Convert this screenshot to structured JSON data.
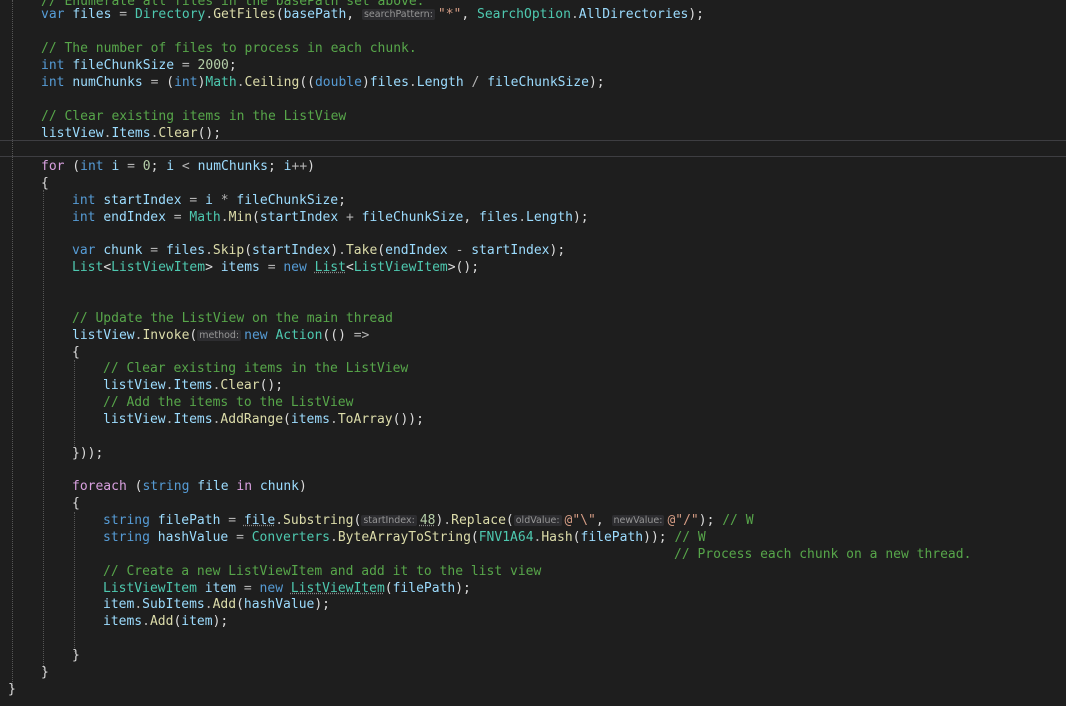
{
  "editor": {
    "language": "C#",
    "theme": {
      "background": "#1e1e1e",
      "keyword": "#569cd6",
      "control_keyword": "#d8a0df",
      "type": "#4ec9b0",
      "identifier": "#9cdcfe",
      "method": "#dcdcaa",
      "number": "#b5cea8",
      "string": "#d69d85",
      "comment": "#57a64a",
      "default": "#dcdcdc",
      "inlay_hint_background": "#2d2d30"
    },
    "lines": [
      [
        [
          "cm",
          "// Enumerate all files in the basePath set above."
        ]
      ],
      [
        [
          "kw",
          "var"
        ],
        [
          "d",
          " "
        ],
        [
          "id",
          "files"
        ],
        [
          "d",
          " "
        ],
        [
          "op",
          "="
        ],
        [
          "d",
          " "
        ],
        [
          "type",
          "Directory"
        ],
        [
          "op",
          "."
        ],
        [
          "fn",
          "GetFiles"
        ],
        [
          "d",
          "("
        ],
        [
          "id",
          "basePath"
        ],
        [
          "d",
          ", "
        ],
        [
          "hint",
          "searchPattern:"
        ],
        [
          "str",
          "\"*\""
        ],
        [
          "d",
          ", "
        ],
        [
          "type",
          "SearchOption"
        ],
        [
          "op",
          "."
        ],
        [
          "id",
          "AllDirectories"
        ],
        [
          "d",
          ");"
        ]
      ],
      [],
      [
        [
          "cm",
          "// The number of files to process in each chunk."
        ]
      ],
      [
        [
          "kw",
          "int"
        ],
        [
          "d",
          " "
        ],
        [
          "id",
          "fileChunkSize"
        ],
        [
          "d",
          " "
        ],
        [
          "op",
          "="
        ],
        [
          "d",
          " "
        ],
        [
          "num",
          "2000"
        ],
        [
          "d",
          ";"
        ]
      ],
      [
        [
          "kw",
          "int"
        ],
        [
          "d",
          " "
        ],
        [
          "id",
          "numChunks"
        ],
        [
          "d",
          " "
        ],
        [
          "op",
          "="
        ],
        [
          "d",
          " ("
        ],
        [
          "kw",
          "int"
        ],
        [
          "d",
          ")"
        ],
        [
          "type",
          "Math"
        ],
        [
          "op",
          "."
        ],
        [
          "fn",
          "Ceiling"
        ],
        [
          "d",
          "(("
        ],
        [
          "kw",
          "double"
        ],
        [
          "d",
          ")"
        ],
        [
          "id",
          "files"
        ],
        [
          "op",
          "."
        ],
        [
          "id",
          "Length"
        ],
        [
          "d",
          " "
        ],
        [
          "op",
          "/"
        ],
        [
          "d",
          " "
        ],
        [
          "id",
          "fileChunkSize"
        ],
        [
          "d",
          ");"
        ]
      ],
      [],
      [
        [
          "cm",
          "// Clear existing items in the ListView"
        ]
      ],
      [
        [
          "id",
          "listView"
        ],
        [
          "op",
          "."
        ],
        [
          "id",
          "Items"
        ],
        [
          "op",
          "."
        ],
        [
          "fn",
          "Clear"
        ],
        [
          "d",
          "();"
        ]
      ],
      [],
      [
        [
          "ctl",
          "for"
        ],
        [
          "d",
          " ("
        ],
        [
          "kw",
          "int"
        ],
        [
          "d",
          " "
        ],
        [
          "id",
          "i"
        ],
        [
          "d",
          " "
        ],
        [
          "op",
          "="
        ],
        [
          "d",
          " "
        ],
        [
          "num",
          "0"
        ],
        [
          "d",
          "; "
        ],
        [
          "id",
          "i"
        ],
        [
          "d",
          " "
        ],
        [
          "op",
          "<"
        ],
        [
          "d",
          " "
        ],
        [
          "id",
          "numChunks"
        ],
        [
          "d",
          "; "
        ],
        [
          "id",
          "i"
        ],
        [
          "op",
          "++"
        ],
        [
          "d",
          ")"
        ]
      ],
      [
        [
          "d",
          "{"
        ]
      ],
      [
        [
          "kw",
          "int"
        ],
        [
          "d",
          " "
        ],
        [
          "id",
          "startIndex"
        ],
        [
          "d",
          " "
        ],
        [
          "op",
          "="
        ],
        [
          "d",
          " "
        ],
        [
          "id",
          "i"
        ],
        [
          "d",
          " "
        ],
        [
          "op",
          "*"
        ],
        [
          "d",
          " "
        ],
        [
          "id",
          "fileChunkSize"
        ],
        [
          "d",
          ";"
        ]
      ],
      [
        [
          "kw",
          "int"
        ],
        [
          "d",
          " "
        ],
        [
          "id",
          "endIndex"
        ],
        [
          "d",
          " "
        ],
        [
          "op",
          "="
        ],
        [
          "d",
          " "
        ],
        [
          "type",
          "Math"
        ],
        [
          "op",
          "."
        ],
        [
          "fn",
          "Min"
        ],
        [
          "d",
          "("
        ],
        [
          "id",
          "startIndex"
        ],
        [
          "d",
          " "
        ],
        [
          "op",
          "+"
        ],
        [
          "d",
          " "
        ],
        [
          "id",
          "fileChunkSize"
        ],
        [
          "d",
          ", "
        ],
        [
          "id",
          "files"
        ],
        [
          "op",
          "."
        ],
        [
          "id",
          "Length"
        ],
        [
          "d",
          ");"
        ]
      ],
      [],
      [
        [
          "kw",
          "var"
        ],
        [
          "d",
          " "
        ],
        [
          "id",
          "chunk"
        ],
        [
          "d",
          " "
        ],
        [
          "op",
          "="
        ],
        [
          "d",
          " "
        ],
        [
          "id",
          "files"
        ],
        [
          "op",
          "."
        ],
        [
          "fn",
          "Skip"
        ],
        [
          "d",
          "("
        ],
        [
          "id",
          "startIndex"
        ],
        [
          "d",
          ")"
        ],
        [
          "op",
          "."
        ],
        [
          "fn",
          "Take"
        ],
        [
          "d",
          "("
        ],
        [
          "id",
          "endIndex"
        ],
        [
          "d",
          " "
        ],
        [
          "op",
          "-"
        ],
        [
          "d",
          " "
        ],
        [
          "id",
          "startIndex"
        ],
        [
          "d",
          ");"
        ]
      ],
      [
        [
          "type",
          "List"
        ],
        [
          "d",
          "<"
        ],
        [
          "type",
          "ListViewItem"
        ],
        [
          "d",
          "> "
        ],
        [
          "id",
          "items"
        ],
        [
          "d",
          " "
        ],
        [
          "op",
          "="
        ],
        [
          "d",
          " "
        ],
        [
          "kw",
          "new"
        ],
        [
          "d",
          " "
        ],
        [
          "type_ul",
          "List"
        ],
        [
          "d",
          "<"
        ],
        [
          "type",
          "ListViewItem"
        ],
        [
          "d",
          ">();"
        ]
      ],
      [],
      [],
      [
        [
          "cm",
          "// Update the ListView on the main thread"
        ]
      ],
      [
        [
          "id",
          "listView"
        ],
        [
          "op",
          "."
        ],
        [
          "fn",
          "Invoke"
        ],
        [
          "d",
          "("
        ],
        [
          "hint",
          "method:"
        ],
        [
          "kw",
          "new"
        ],
        [
          "d",
          " "
        ],
        [
          "type",
          "Action"
        ],
        [
          "d",
          "(() "
        ],
        [
          "op",
          "=>"
        ]
      ],
      [
        [
          "d",
          "{"
        ]
      ],
      [
        [
          "cm",
          "// Clear existing items in the ListView"
        ]
      ],
      [
        [
          "id",
          "listView"
        ],
        [
          "op",
          "."
        ],
        [
          "id",
          "Items"
        ],
        [
          "op",
          "."
        ],
        [
          "fn",
          "Clear"
        ],
        [
          "d",
          "();"
        ]
      ],
      [
        [
          "cm",
          "// Add the items to the ListView"
        ]
      ],
      [
        [
          "id",
          "listView"
        ],
        [
          "op",
          "."
        ],
        [
          "id",
          "Items"
        ],
        [
          "op",
          "."
        ],
        [
          "fn",
          "AddRange"
        ],
        [
          "d",
          "("
        ],
        [
          "id",
          "items"
        ],
        [
          "op",
          "."
        ],
        [
          "fn",
          "ToArray"
        ],
        [
          "d",
          "());"
        ]
      ],
      [],
      [
        [
          "d",
          "}));"
        ]
      ],
      [],
      [
        [
          "ctl",
          "foreach"
        ],
        [
          "d",
          " ("
        ],
        [
          "kw",
          "string"
        ],
        [
          "d",
          " "
        ],
        [
          "id",
          "file"
        ],
        [
          "d",
          " "
        ],
        [
          "ctl",
          "in"
        ],
        [
          "d",
          " "
        ],
        [
          "id",
          "chunk"
        ],
        [
          "d",
          ")"
        ]
      ],
      [
        [
          "d",
          "{"
        ]
      ],
      [
        [
          "kw",
          "string"
        ],
        [
          "d",
          " "
        ],
        [
          "id",
          "filePath"
        ],
        [
          "d",
          " "
        ],
        [
          "op",
          "="
        ],
        [
          "d",
          " "
        ],
        [
          "id_ul",
          "file"
        ],
        [
          "op",
          "."
        ],
        [
          "fn",
          "Substring"
        ],
        [
          "d",
          "("
        ],
        [
          "hint",
          "startIndex:"
        ],
        [
          "num_ul",
          "48"
        ],
        [
          "d",
          ")"
        ],
        [
          "op",
          "."
        ],
        [
          "fn",
          "Replace"
        ],
        [
          "d",
          "("
        ],
        [
          "hint",
          "oldValue:"
        ],
        [
          "str",
          "@\"\\\""
        ],
        [
          "d",
          ", "
        ],
        [
          "hint",
          "newValue:"
        ],
        [
          "str",
          "@\"/\""
        ],
        [
          "d",
          "); "
        ],
        [
          "cm",
          "// W"
        ]
      ],
      [
        [
          "kw",
          "string"
        ],
        [
          "d",
          " "
        ],
        [
          "id",
          "hashValue"
        ],
        [
          "d",
          " "
        ],
        [
          "op",
          "="
        ],
        [
          "d",
          " "
        ],
        [
          "type",
          "Converters"
        ],
        [
          "op",
          "."
        ],
        [
          "fn",
          "ByteArrayToString"
        ],
        [
          "d",
          "("
        ],
        [
          "type",
          "FNV1A64"
        ],
        [
          "op",
          "."
        ],
        [
          "fn",
          "Hash"
        ],
        [
          "d",
          "("
        ],
        [
          "id",
          "filePath"
        ],
        [
          "d",
          "));"
        ],
        [
          "d",
          " "
        ],
        [
          "cm",
          "// W"
        ]
      ],
      [
        [
          "cm",
          "// Process each chunk on a new thread."
        ]
      ],
      [
        [
          "cm",
          "// Create a new ListViewItem and add it to the list view"
        ]
      ],
      [
        [
          "type",
          "ListViewItem"
        ],
        [
          "d",
          " "
        ],
        [
          "id",
          "item"
        ],
        [
          "d",
          " "
        ],
        [
          "op",
          "="
        ],
        [
          "d",
          " "
        ],
        [
          "kw",
          "new"
        ],
        [
          "d",
          " "
        ],
        [
          "type_ul",
          "ListViewItem"
        ],
        [
          "d",
          "("
        ],
        [
          "id",
          "filePath"
        ],
        [
          "d",
          ");"
        ]
      ],
      [
        [
          "id",
          "item"
        ],
        [
          "op",
          "."
        ],
        [
          "id",
          "SubItems"
        ],
        [
          "op",
          "."
        ],
        [
          "fn",
          "Add"
        ],
        [
          "d",
          "("
        ],
        [
          "id",
          "hashValue"
        ],
        [
          "d",
          ");"
        ]
      ],
      [
        [
          "id",
          "items"
        ],
        [
          "op",
          "."
        ],
        [
          "fn",
          "Add"
        ],
        [
          "d",
          "("
        ],
        [
          "id",
          "item"
        ],
        [
          "d",
          ");"
        ]
      ],
      [],
      [
        [
          "d",
          "}"
        ]
      ],
      [
        [
          "d",
          "}"
        ]
      ],
      [
        [
          "d",
          "}"
        ]
      ]
    ]
  }
}
